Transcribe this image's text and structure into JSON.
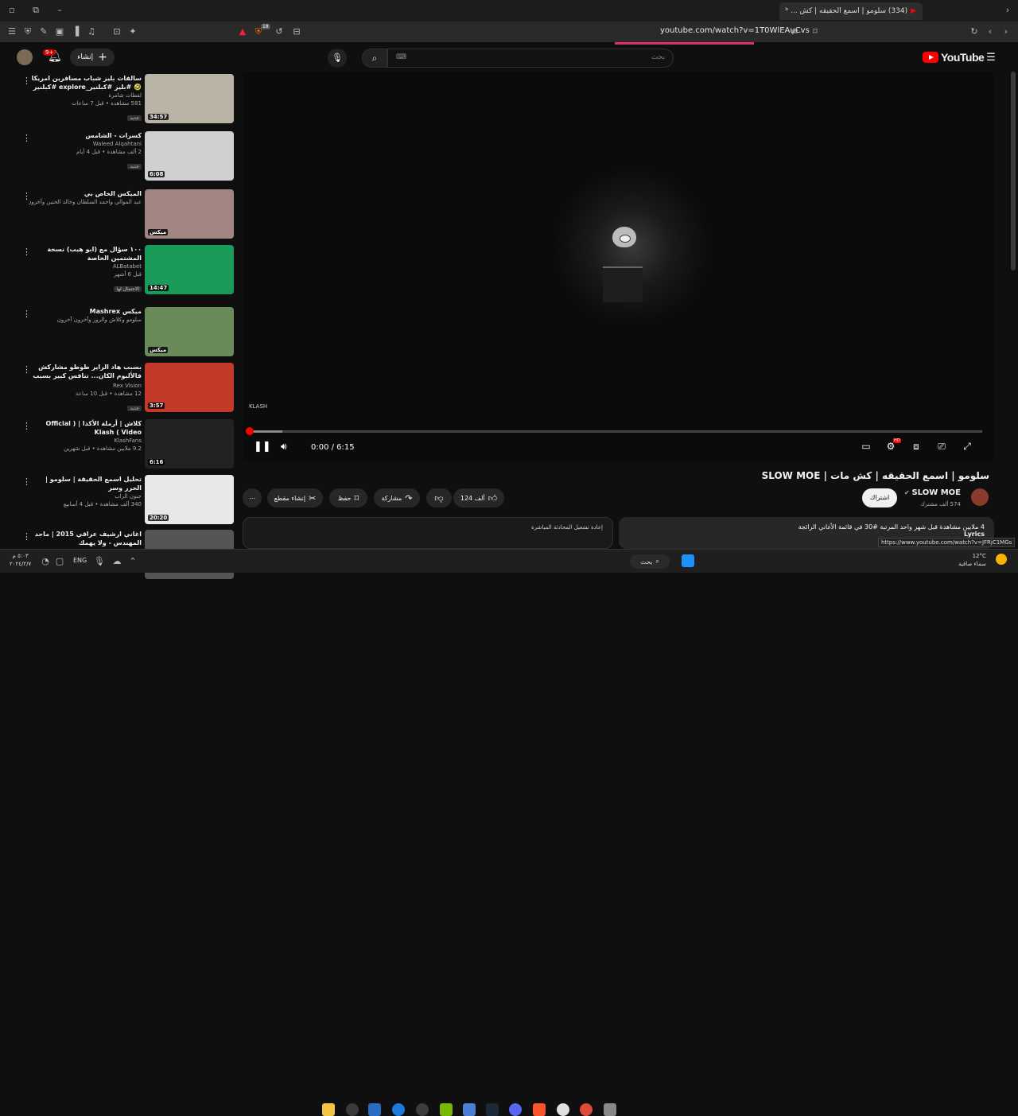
{
  "browser": {
    "tab_title": "(334) سلومو | اسمع الحقيقه | كش ... ᵇ",
    "url": "youtube.com/watch?v=1T0WlEAuCvs",
    "shield_count": "18"
  },
  "header": {
    "search_placeholder": "بحث",
    "create_label": "إنشاء",
    "notif_count": "9+",
    "logo_text": "YouTube"
  },
  "player": {
    "time": "0:00 / 6:15",
    "watermark": "KLASH",
    "progress": 0.003,
    "hd_badge": "HD"
  },
  "video": {
    "title": "سلومو | اسمع الحقيقه | كش مات | SLOW MOE",
    "channel": "SLOW MOE",
    "subscribers": "574 ألف مشترك",
    "subscribe_label": "اشتراك",
    "likes": "124 ألف",
    "share_label": "مشاركة",
    "save_label": "حفظ",
    "clip_label": "إنشاء مقطع",
    "description_stats": "4 ملايين مشاهدة قبل شهر واحد المرتبة #30 في قائمة الأغاني الرائجة",
    "description_more": "Lyrics",
    "chat_label": "إعادة تشغيل المحادثة المباشرة",
    "status_url": "https://www.youtube.com/watch?v=JFRjC1MGs"
  },
  "recommendations": [
    {
      "title": "سالفات بليز شباب مسافرين امريكا 🤣 #بليز #كبلنير_explore #كبلنير",
      "channel": "لقطات شامرة",
      "stats": "581 مشاهدة • قبل 7 ساعات",
      "tag": "جديد",
      "duration": "34:57",
      "color": "#b9b3a6"
    },
    {
      "title": "كسرات - الشامس",
      "channel": "Waleed Alqahtani",
      "stats": "2 ألف مشاهدة • قبل 4 أيام",
      "tag": "جديد",
      "duration": "6:08",
      "color": "#d0d0d0"
    },
    {
      "title": "الميكس الخاص بي",
      "channel": "عبد الموالي واحمد السلطان وخالد الحنين وآخرون آخرون",
      "stats": "",
      "tag": "",
      "duration": "ميكس",
      "color": "#a08580"
    },
    {
      "title": "١٠٠ سؤال مع (ابو هيب) نسخة المشتمين الخاصة",
      "channel": "ALBatabet",
      "stats": "قبل 6 أشهر",
      "tag": "الاحتمال لها",
      "duration": "14:47",
      "color": "#1a9b5a"
    },
    {
      "title": "ميكس Mashrex",
      "channel": "سلومو وكلاش والروز وآخرون آخرون",
      "stats": "",
      "tag": "",
      "duration": "ميكس",
      "color": "#6a8a5a"
    },
    {
      "title": "بسبب هاد الراير طوطو مشاركش فالألبوم الكان... تنافس كبير بسبب خروج ...",
      "channel": "Rex Vision",
      "stats": "12 مشاهدة • قبل 10 ساعة",
      "tag": "جديد",
      "duration": "3:57",
      "color": "#c43a2a"
    },
    {
      "title": "كلاش | أرملة الأكذا | ( Official Video ) Klash",
      "channel": "KlashFans",
      "stats": "9.2 ملايين مشاهدة • قبل شهرين",
      "tag": "",
      "duration": "6:16",
      "color": "#222222"
    },
    {
      "title": "تحليل اسمع الحقيقة | سلومو | الحرر وسر",
      "channel": "جنون الراب",
      "stats": "340 ألف مشاهدة • قبل 4 أسابيع",
      "tag": "",
      "duration": "20:20",
      "color": "#e8e8e8"
    },
    {
      "title": "اغاني ارشيف عراقي 2015 | ماجد المهندس - ولا يهمك",
      "channel": "",
      "stats": "",
      "tag": "",
      "duration": "",
      "color": "#555555"
    }
  ],
  "taskbar": {
    "search_label": "بحث",
    "lang": "ENG",
    "temperature": "12°C",
    "weather": "سماء صافية",
    "clock_time": "٥:٠٣ م",
    "clock_date": "٢٠٢٤/٢/٧"
  }
}
